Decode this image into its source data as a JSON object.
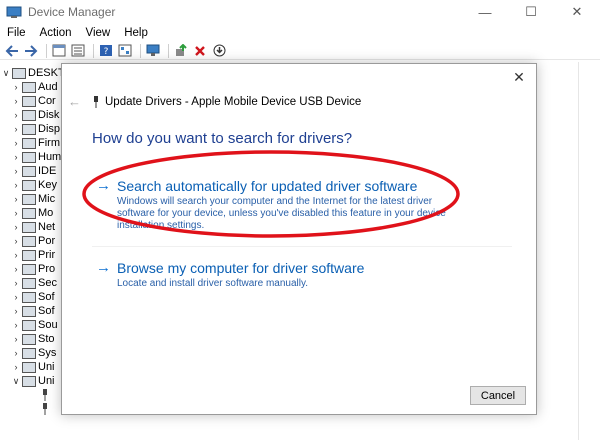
{
  "window": {
    "title": "Device Manager",
    "controls": {
      "minimize": "—",
      "maximize": "☐",
      "close": "✕"
    }
  },
  "menu": [
    "File",
    "Action",
    "View",
    "Help"
  ],
  "toolbar": {
    "icons": [
      "back-arrow-icon",
      "forward-arrow-icon",
      "properties-icon",
      "list-icon",
      "help-icon",
      "details-icon",
      "monitor-icon",
      "update-driver-icon",
      "uninstall-icon",
      "download-icon"
    ]
  },
  "tree": {
    "root_label": "DESKTO",
    "items": [
      "Aud",
      "Cor",
      "Disk",
      "Disp",
      "Firm",
      "Hum",
      "IDE",
      "Key",
      "Mic",
      "Mo",
      "Net",
      "Por",
      "Prir",
      "Pro",
      "Sec",
      "Sof",
      "Sof",
      "Sou",
      "Sto",
      "Sys",
      "Uni",
      "Uni"
    ]
  },
  "dialog": {
    "close_symbol": "✕",
    "back_symbol": "←",
    "header": "Update Drivers - Apple Mobile Device USB Device",
    "question": "How do you want to search for drivers?",
    "options": [
      {
        "arrow": "→",
        "title": "Search automatically for updated driver software",
        "description": "Windows will search your computer and the Internet for the latest driver software for your device, unless you've disabled this feature in your device installation settings."
      },
      {
        "arrow": "→",
        "title": "Browse my computer for driver software",
        "description": "Locate and install driver software manually."
      }
    ],
    "cancel_label": "Cancel"
  },
  "colors": {
    "link_blue": "#0a5fb4",
    "question_blue": "#1e3f91",
    "annotation_red": "#e0121a"
  }
}
